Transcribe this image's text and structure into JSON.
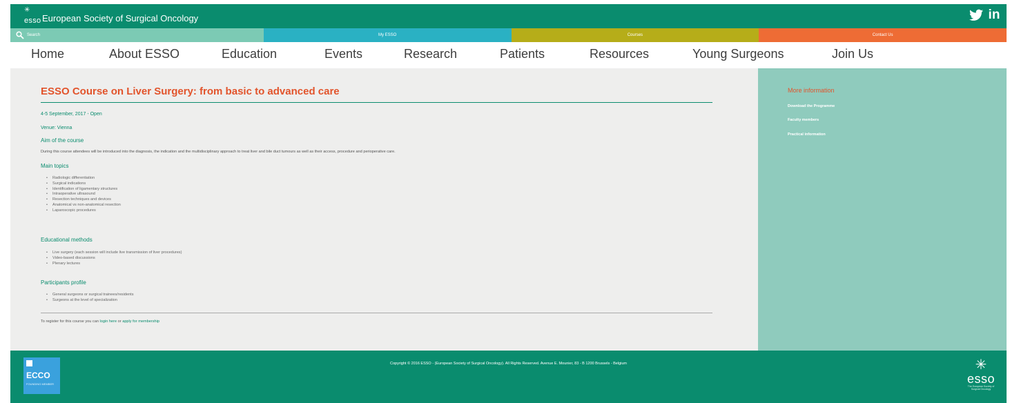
{
  "header": {
    "logo_text": "esso",
    "brand_name": "European Society of Surgical Oncology"
  },
  "strip": {
    "search_placeholder": "Search",
    "my_esso": "My ESSO",
    "courses": "Courses",
    "contact_us": "Contact Us"
  },
  "nav": {
    "items": [
      {
        "label": "Home"
      },
      {
        "label": "About ESSO"
      },
      {
        "label": "Education"
      },
      {
        "label": "Events"
      },
      {
        "label": "Research"
      },
      {
        "label": "Patients"
      },
      {
        "label": "Resources"
      },
      {
        "label": "Young Surgeons"
      },
      {
        "label": "Join Us"
      }
    ]
  },
  "main": {
    "title": "ESSO Course on Liver Surgery: from basic to advanced care",
    "date": "4-5 September, 2017 - Open",
    "venue": "Venue: Vienna",
    "aim_heading": "Aim of the course",
    "aim_text": "During this course attendees will be introduced into the diagnosis, the indication and the multidisciplinary approach to treat liver and bile duct tumours as well as their access, procedure and perioperative care.",
    "topics_heading": "Main topics",
    "topics": [
      "Radiologic differentiation",
      "Surgical indications",
      "Identification of ligamentary structures",
      "Intraoperative ultrasound",
      "Resection techniques and devices",
      "Anatomical vs non-anatomical resection",
      "Laparoscopic procedures"
    ],
    "methods_heading": "Educational methods",
    "methods": [
      "Live surgery (each session will include live transmission of liver procedures)",
      "Video-based discussions",
      "Plenary lectures"
    ],
    "profile_heading": "Participants profile",
    "profile": [
      "General surgeons or surgical trainees/residents",
      "Surgeons at the level of specialization"
    ],
    "register_prefix": "To register for this course you can",
    "register_login": "login here",
    "register_or": "or",
    "register_apply": "apply for membership"
  },
  "sidebar": {
    "title": "More information",
    "links": [
      "Download the Programme",
      "Faculty members",
      "Practical information"
    ]
  },
  "footer": {
    "ecco_name": "ECCO",
    "ecco_sub": "FOUNDING MEMBER",
    "copyright": "Copyright © 2016 ESSO - (European Society of Surgical Oncology). All Rights Reserved. Avenue E. Mounier, 83 - B 1200 Brussels - Belgium",
    "esso_name": "esso",
    "esso_sub": "The European Society of Surgical Oncology"
  },
  "colors": {
    "brand_green": "#0a8c6e",
    "search_green": "#7ccab4",
    "myesso_blue": "#2ab1c3",
    "courses_olive": "#b6ad19",
    "contact_orange": "#ee6c35",
    "title_orange": "#e2542c",
    "sidebar_green": "#8fcbbd"
  },
  "icons": [
    "search-icon",
    "twitter-icon",
    "linkedin-icon"
  ]
}
